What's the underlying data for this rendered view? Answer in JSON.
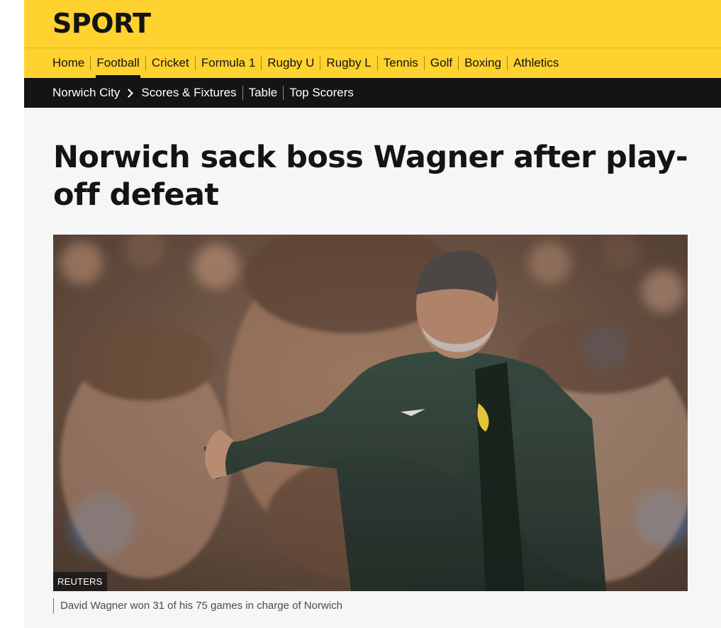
{
  "brand": "SPORT",
  "primary_nav": [
    {
      "label": "Home",
      "active": false
    },
    {
      "label": "Football",
      "active": true
    },
    {
      "label": "Cricket",
      "active": false
    },
    {
      "label": "Formula 1",
      "active": false
    },
    {
      "label": "Rugby U",
      "active": false
    },
    {
      "label": "Rugby L",
      "active": false
    },
    {
      "label": "Tennis",
      "active": false
    },
    {
      "label": "Golf",
      "active": false
    },
    {
      "label": "Boxing",
      "active": false
    },
    {
      "label": "Athletics",
      "active": false
    }
  ],
  "secondary_nav": {
    "team": "Norwich City",
    "links": [
      "Scores & Fixtures",
      "Table",
      "Top Scorers"
    ]
  },
  "article": {
    "headline": "Norwich sack boss Wagner after play-off defeat",
    "image_credit": "REUTERS",
    "caption": "David Wagner won 31 of his 75 games in charge of Norwich"
  },
  "colors": {
    "brand_yellow": "#ffd230",
    "nav_dark": "#141414",
    "page_bg": "#f6f6f6"
  }
}
